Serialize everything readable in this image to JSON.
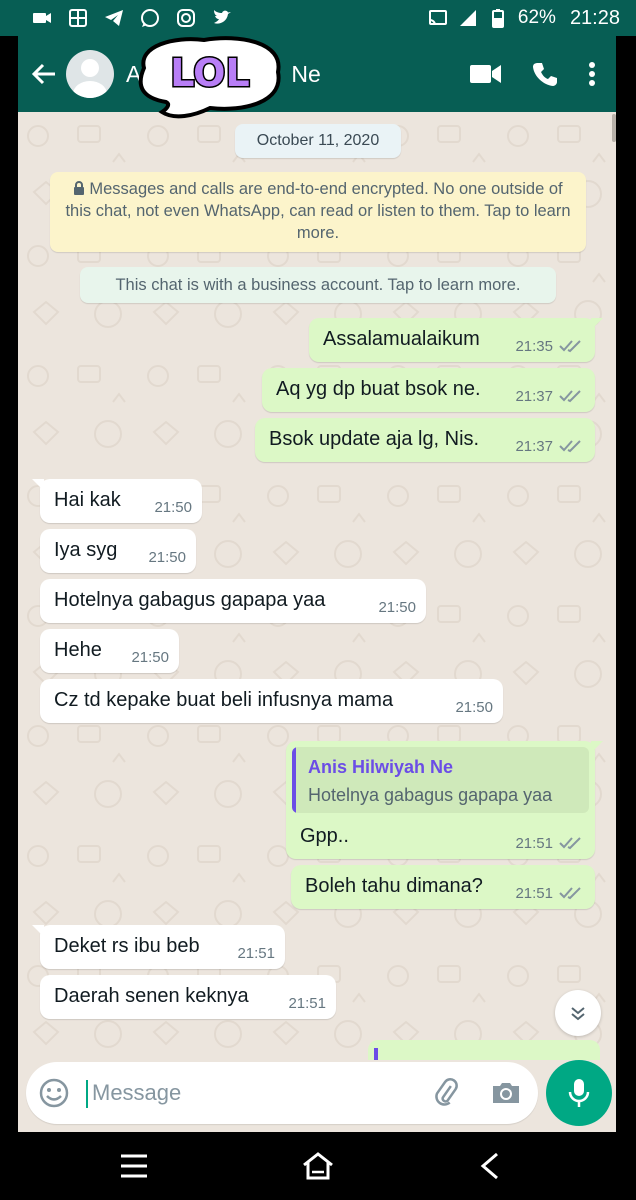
{
  "status_bar": {
    "battery": "62%",
    "time": "21:28"
  },
  "chat_header": {
    "contact_name": "A",
    "contact_name_suffix": "Ne",
    "sticker_text": "LOL"
  },
  "chat": {
    "date": "October 11, 2020",
    "encryption_notice": "Messages and calls are end-to-end encrypted. No one outside of this chat, not even WhatsApp, can read or listen to them. Tap to learn more.",
    "business_notice": "This chat is with a business account. Tap to learn more.",
    "messages": [
      {
        "dir": "out",
        "text": "Assalamualaikum",
        "time": "21:35"
      },
      {
        "dir": "out",
        "text": "Aq yg dp buat bsok ne.",
        "time": "21:37"
      },
      {
        "dir": "out",
        "text": "Bsok update aja lg, Nis.",
        "time": "21:37"
      },
      {
        "dir": "in",
        "text": "Hai kak",
        "time": "21:50"
      },
      {
        "dir": "in",
        "text": "Iya syg",
        "time": "21:50"
      },
      {
        "dir": "in",
        "text": "Hotelnya gabagus gapapa yaa",
        "time": "21:50"
      },
      {
        "dir": "in",
        "text": "Hehe",
        "time": "21:50"
      },
      {
        "dir": "in",
        "text": "Cz td kepake buat beli infusnya mama",
        "time": "21:50"
      },
      {
        "dir": "out",
        "text": "Gpp..",
        "time": "21:51",
        "quote_name": "Anis Hilwiyah Ne",
        "quote_text": "Hotelnya gabagus gapapa yaa"
      },
      {
        "dir": "out",
        "text": "Boleh tahu dimana?",
        "time": "21:51"
      },
      {
        "dir": "in",
        "text": "Deket rs ibu beb",
        "time": "21:51"
      },
      {
        "dir": "in",
        "text": "Daerah senen keknya",
        "time": "21:51"
      }
    ]
  },
  "composer": {
    "placeholder": "Message"
  },
  "icons": [
    "camera-icon",
    "gallery-icon",
    "telegram-icon",
    "whatsapp-icon",
    "instagram-icon",
    "twitter-icon",
    "cast-icon",
    "signal-icon",
    "battery-icon",
    "back-arrow-icon",
    "video-call-icon",
    "voice-call-icon",
    "more-icon",
    "read-receipt-icon",
    "chevron-down-icon",
    "emoji-icon",
    "attach-icon",
    "camera-icon",
    "mic-icon",
    "menu-icon",
    "home-icon",
    "back-icon"
  ],
  "colors": {
    "header": "#075E54",
    "outgoing_bubble": "#dcf8c6",
    "incoming_bubble": "#ffffff",
    "accent": "#00a884",
    "chat_background": "#ece5dd",
    "quote_accent": "#6b4de6"
  }
}
